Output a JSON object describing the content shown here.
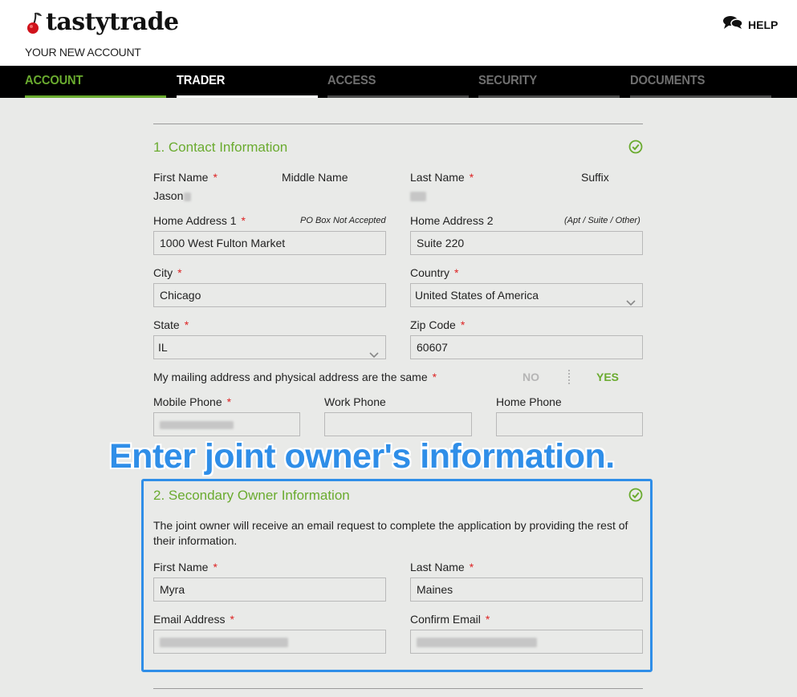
{
  "header": {
    "logo_text": "tastytrade",
    "subtitle": "YOUR NEW ACCOUNT",
    "help_label": "HELP"
  },
  "nav": {
    "tabs": [
      {
        "label": "ACCOUNT",
        "color": "#6aab2f",
        "bar": "#6aab2f"
      },
      {
        "label": "TRADER",
        "color": "#ffffff",
        "bar": "#ffffff"
      },
      {
        "label": "ACCESS",
        "color": "#6f6f6f",
        "bar": "#4a4a4a"
      },
      {
        "label": "SECURITY",
        "color": "#6f6f6f",
        "bar": "#4a4a4a"
      },
      {
        "label": "DOCUMENTS",
        "color": "#6f6f6f",
        "bar": "#4a4a4a"
      }
    ]
  },
  "contact": {
    "title": "1. Contact Information",
    "first_name_label": "First Name",
    "first_name_value": "Jason",
    "middle_name_label": "Middle Name",
    "last_name_label": "Last Name",
    "suffix_label": "Suffix",
    "home_address1_label": "Home Address 1",
    "home_address1_hint": "PO Box Not Accepted",
    "home_address1_value": "1000 West Fulton Market",
    "home_address2_label": "Home Address 2",
    "home_address2_hint": "(Apt / Suite / Other)",
    "home_address2_value": "Suite 220",
    "city_label": "City",
    "city_value": "Chicago",
    "country_label": "Country",
    "country_value": "United States of America",
    "state_label": "State",
    "state_value": "IL",
    "zip_label": "Zip Code",
    "zip_value": "60607",
    "mailing_same_label": "My mailing address and physical address are the same",
    "toggle_no": "NO",
    "toggle_yes": "YES",
    "mobile_phone_label": "Mobile Phone",
    "work_phone_label": "Work Phone",
    "home_phone_label": "Home Phone"
  },
  "overlay": {
    "caption": "Enter joint owner's information."
  },
  "secondary": {
    "title": "2. Secondary Owner Information",
    "description": "The joint owner will receive an email request to complete the application by providing the rest of their information.",
    "first_name_label": "First Name",
    "first_name_value": "Myra",
    "last_name_label": "Last Name",
    "last_name_value": "Maines",
    "email_label": "Email Address",
    "confirm_email_label": "Confirm Email"
  },
  "required_marker": "*",
  "colors": {
    "accent_green": "#6aab2f",
    "required_red": "#dd2222",
    "callout_blue": "#2f8ee8"
  }
}
